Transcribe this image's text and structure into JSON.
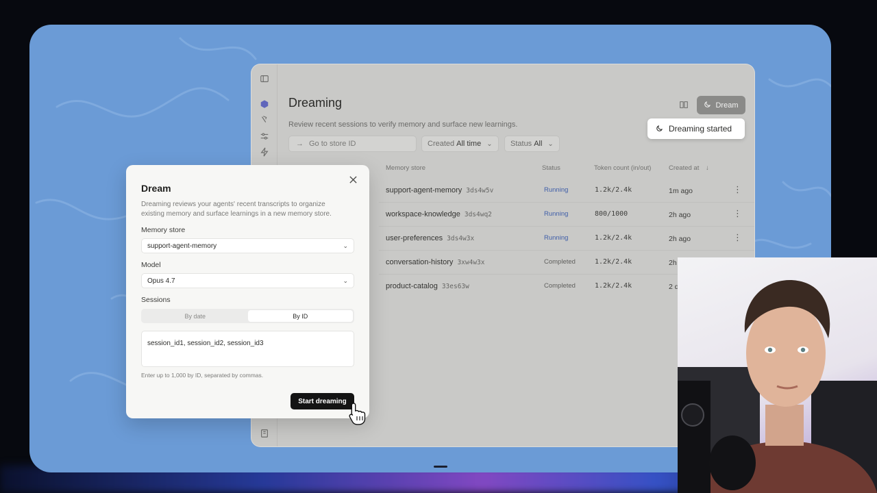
{
  "app": {
    "page_title": "Dreaming",
    "page_subtitle": "Review recent sessions to verify memory and surface new learnings.",
    "dream_button_label": "Dream",
    "search_placeholder": "Go to store ID",
    "filters": [
      {
        "name": "Created",
        "value": "All time"
      },
      {
        "name": "Status",
        "value": "All"
      }
    ],
    "columns": [
      "Memory store",
      "Status",
      "Token count (in/out)",
      "Created at"
    ],
    "rows": [
      {
        "store": "support-agent-memory",
        "id": "3ds4w5v",
        "status": "Running",
        "tokens": "1.2k/2.4k",
        "created": "1m ago"
      },
      {
        "store": "workspace-knowledge",
        "id": "3ds4wq2",
        "status": "Running",
        "tokens": "800/1000",
        "created": "2h ago"
      },
      {
        "store": "user-preferences",
        "id": "3ds4w3x",
        "status": "Running",
        "tokens": "1.2k/2.4k",
        "created": "2h ago"
      },
      {
        "store": "conversation-history",
        "id": "3xw4w3x",
        "status": "Completed",
        "tokens": "1.2k/2.4k",
        "created": "2h ago"
      },
      {
        "store": "product-catalog",
        "id": "33es63w",
        "status": "Completed",
        "tokens": "1.2k/2.4k",
        "created": "2 d"
      }
    ]
  },
  "toast": {
    "text": "Dreaming started"
  },
  "modal": {
    "title": "Dream",
    "description": "Dreaming reviews your agents' recent transcripts to organize existing memory and surface learnings in a new memory store.",
    "memory_store_label": "Memory store",
    "memory_store_value": "support-agent-memory",
    "model_label": "Model",
    "model_value": "Opus 4.7",
    "sessions_label": "Sessions",
    "session_tabs": [
      "By date",
      "By ID"
    ],
    "active_session_tab": "By ID",
    "session_ids_value": "session_id1, session_id2, session_id3",
    "hint": "Enter up to 1,000 by ID, separated by commas.",
    "submit_label": "Start dreaming"
  },
  "colors": {
    "stage_bg": "#6b9bd6",
    "running": "#3f5ea8",
    "primary_button": "#141414"
  }
}
